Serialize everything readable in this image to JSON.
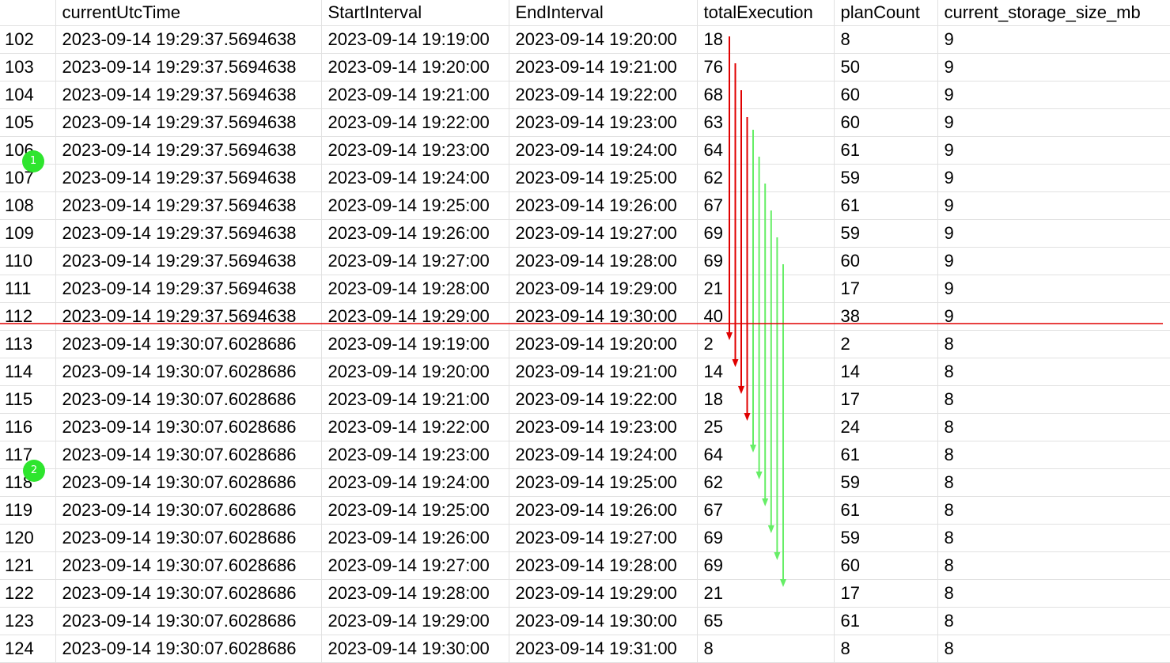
{
  "grid": {
    "columns": [
      "",
      "currentUtcTime",
      "StartInterval",
      "EndInterval",
      "totalExecution",
      "planCount",
      "current_storage_size_mb"
    ],
    "rows": [
      [
        "102",
        "2023-09-14 19:29:37.5694638",
        "2023-09-14 19:19:00",
        "2023-09-14 19:20:00",
        "18",
        "8",
        "9"
      ],
      [
        "103",
        "2023-09-14 19:29:37.5694638",
        "2023-09-14 19:20:00",
        "2023-09-14 19:21:00",
        "76",
        "50",
        "9"
      ],
      [
        "104",
        "2023-09-14 19:29:37.5694638",
        "2023-09-14 19:21:00",
        "2023-09-14 19:22:00",
        "68",
        "60",
        "9"
      ],
      [
        "105",
        "2023-09-14 19:29:37.5694638",
        "2023-09-14 19:22:00",
        "2023-09-14 19:23:00",
        "63",
        "60",
        "9"
      ],
      [
        "106",
        "2023-09-14 19:29:37.5694638",
        "2023-09-14 19:23:00",
        "2023-09-14 19:24:00",
        "64",
        "61",
        "9"
      ],
      [
        "107",
        "2023-09-14 19:29:37.5694638",
        "2023-09-14 19:24:00",
        "2023-09-14 19:25:00",
        "62",
        "59",
        "9"
      ],
      [
        "108",
        "2023-09-14 19:29:37.5694638",
        "2023-09-14 19:25:00",
        "2023-09-14 19:26:00",
        "67",
        "61",
        "9"
      ],
      [
        "109",
        "2023-09-14 19:29:37.5694638",
        "2023-09-14 19:26:00",
        "2023-09-14 19:27:00",
        "69",
        "59",
        "9"
      ],
      [
        "110",
        "2023-09-14 19:29:37.5694638",
        "2023-09-14 19:27:00",
        "2023-09-14 19:28:00",
        "69",
        "60",
        "9"
      ],
      [
        "111",
        "2023-09-14 19:29:37.5694638",
        "2023-09-14 19:28:00",
        "2023-09-14 19:29:00",
        "21",
        "17",
        "9"
      ],
      [
        "112",
        "2023-09-14 19:29:37.5694638",
        "2023-09-14 19:29:00",
        "2023-09-14 19:30:00",
        "40",
        "38",
        "9"
      ],
      [
        "113",
        "2023-09-14 19:30:07.6028686",
        "2023-09-14 19:19:00",
        "2023-09-14 19:20:00",
        "2",
        "2",
        "8"
      ],
      [
        "114",
        "2023-09-14 19:30:07.6028686",
        "2023-09-14 19:20:00",
        "2023-09-14 19:21:00",
        "14",
        "14",
        "8"
      ],
      [
        "115",
        "2023-09-14 19:30:07.6028686",
        "2023-09-14 19:21:00",
        "2023-09-14 19:22:00",
        "18",
        "17",
        "8"
      ],
      [
        "116",
        "2023-09-14 19:30:07.6028686",
        "2023-09-14 19:22:00",
        "2023-09-14 19:23:00",
        "25",
        "24",
        "8"
      ],
      [
        "117",
        "2023-09-14 19:30:07.6028686",
        "2023-09-14 19:23:00",
        "2023-09-14 19:24:00",
        "64",
        "61",
        "8"
      ],
      [
        "118",
        "2023-09-14 19:30:07.6028686",
        "2023-09-14 19:24:00",
        "2023-09-14 19:25:00",
        "62",
        "59",
        "8"
      ],
      [
        "119",
        "2023-09-14 19:30:07.6028686",
        "2023-09-14 19:25:00",
        "2023-09-14 19:26:00",
        "67",
        "61",
        "8"
      ],
      [
        "120",
        "2023-09-14 19:30:07.6028686",
        "2023-09-14 19:26:00",
        "2023-09-14 19:27:00",
        "69",
        "59",
        "8"
      ],
      [
        "121",
        "2023-09-14 19:30:07.6028686",
        "2023-09-14 19:27:00",
        "2023-09-14 19:28:00",
        "69",
        "60",
        "8"
      ],
      [
        "122",
        "2023-09-14 19:30:07.6028686",
        "2023-09-14 19:28:00",
        "2023-09-14 19:29:00",
        "21",
        "17",
        "8"
      ],
      [
        "123",
        "2023-09-14 19:30:07.6028686",
        "2023-09-14 19:29:00",
        "2023-09-14 19:30:00",
        "65",
        "61",
        "8"
      ],
      [
        "124",
        "2023-09-14 19:30:07.6028686",
        "2023-09-14 19:30:00",
        "2023-09-14 19:31:00",
        "8",
        "8",
        "8"
      ]
    ]
  },
  "annotations": {
    "markers": [
      "1",
      "2"
    ],
    "colors": {
      "red": "#e00000",
      "green": "#66ee66",
      "marker": "#2ee52e",
      "divider": "#e00000"
    },
    "red_arrows": [
      {
        "from_row": "102",
        "to_row": "113"
      },
      {
        "from_row": "103",
        "to_row": "114"
      },
      {
        "from_row": "104",
        "to_row": "115"
      },
      {
        "from_row": "105",
        "to_row": "116"
      }
    ],
    "green_arrows": [
      {
        "from_row": "106",
        "to_row": "117"
      },
      {
        "from_row": "107",
        "to_row": "118"
      },
      {
        "from_row": "108",
        "to_row": "119"
      },
      {
        "from_row": "109",
        "to_row": "120"
      },
      {
        "from_row": "110",
        "to_row": "121"
      },
      {
        "from_row": "111",
        "to_row": "122"
      }
    ],
    "divider_after_row": "112"
  }
}
